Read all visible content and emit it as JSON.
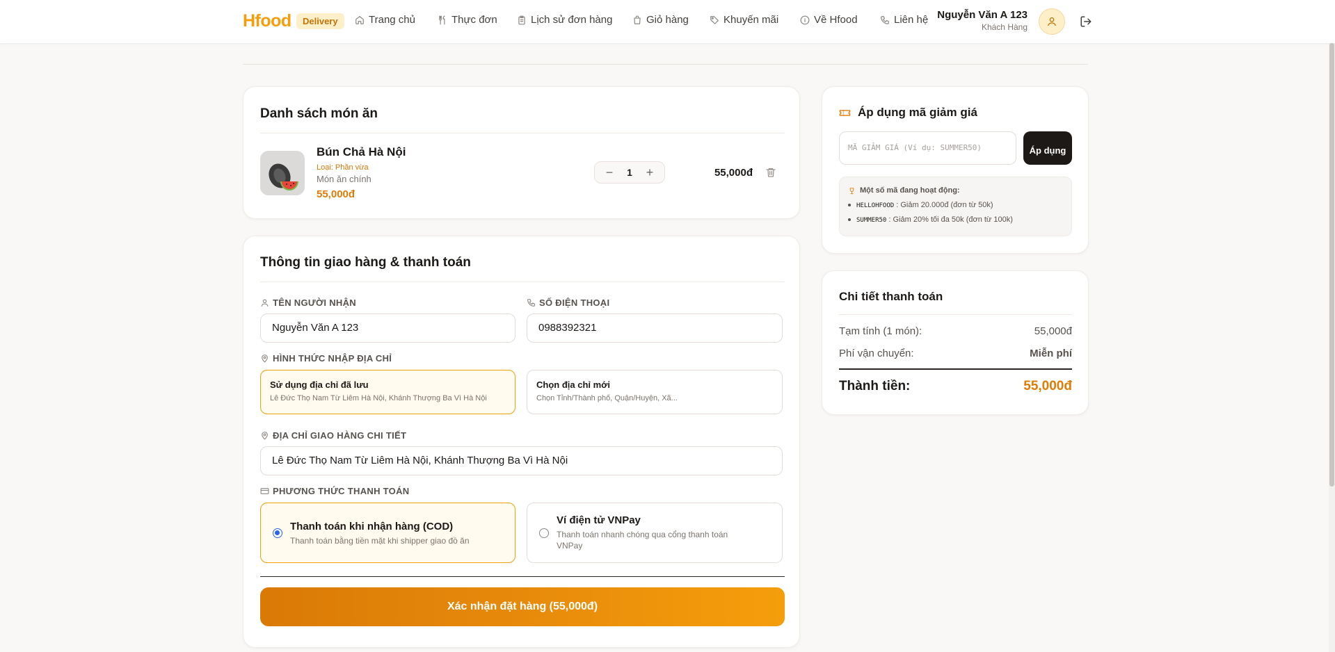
{
  "header": {
    "logo": "Hfood",
    "badge": "Delivery",
    "nav": [
      {
        "label": "Trang chủ",
        "icon": "home-icon"
      },
      {
        "label": "Thực đơn",
        "icon": "utensils-icon"
      },
      {
        "label": "Lịch sử đơn hàng",
        "icon": "clipboard-icon"
      },
      {
        "label": "Giỏ hàng",
        "icon": "shopping-bag-icon"
      },
      {
        "label": "Khuyến mãi",
        "icon": "tag-icon"
      },
      {
        "label": "Về Hfood",
        "icon": "info-icon"
      },
      {
        "label": "Liên hệ",
        "icon": "phone-icon"
      }
    ],
    "user_name": "Nguyễn Văn A 123",
    "user_role": "Khách Hàng"
  },
  "cart": {
    "title": "Danh sách món ăn",
    "items": [
      {
        "name": "Bún Chả Hà Nội",
        "type": "Loại: Phần vừa",
        "category": "Món ăn chính",
        "price": "55,000đ",
        "quantity": "1",
        "total": "55,000đ"
      }
    ]
  },
  "shipping": {
    "title": "Thông tin giao hàng & thanh toán",
    "receiver_label": "TÊN NGƯỜI NHẬN",
    "receiver_value": "Nguyễn Văn A 123",
    "phone_label": "SỐ ĐIỆN THOẠI",
    "phone_value": "0988392321",
    "address_mode_label": "HÌNH THỨC NHẬP ĐỊA CHỈ",
    "saved_title": "Sử dụng địa chỉ đã lưu",
    "saved_sub": "Lê Đức Thọ Nam Từ Liêm Hà Nội, Khánh Thượng Ba Vì Hà Nội",
    "new_title": "Chọn địa chỉ mới",
    "new_sub": "Chọn Tỉnh/Thành phố, Quận/Huyện, Xã...",
    "detail_label": "ĐỊA CHỈ GIAO HÀNG CHI TIẾT",
    "detail_value": "Lê Đức Thọ Nam Từ Liêm Hà Nội, Khánh Thượng Ba Vì Hà Nội",
    "payment_label": "PHƯƠNG THỨC THANH TOÁN",
    "cod_title": "Thanh toán khi nhận hàng (COD)",
    "cod_sub": "Thanh toán bằng tiền mặt khi shipper giao đồ ăn",
    "vnpay_title": "Ví điện tử VNPay",
    "vnpay_sub": "Thanh toán nhanh chóng qua cổng thanh toán VNPay",
    "confirm_label": "Xác nhận đặt hàng (55,000đ)"
  },
  "coupon": {
    "title": "Áp dụng mã giảm giá",
    "placeholder": "MÃ GIẢM GIÁ (Ví dụ: SUMMER50)",
    "apply_label": "Áp dụng",
    "promo_head": "Một số mã đang hoạt động:",
    "promos": [
      {
        "code": "HELLOHFOOD",
        "desc": ": Giảm 20.000đ (đơn từ 50k)"
      },
      {
        "code": "SUMMER50",
        "desc": ": Giảm 20% tối đa 50k (đơn từ 100k)"
      }
    ]
  },
  "summary": {
    "title": "Chi tiết thanh toán",
    "subtotal_label": "Tạm tính (1 món):",
    "subtotal_value": "55,000đ",
    "shipping_label": "Phí vận chuyển:",
    "shipping_value": "Miễn phí",
    "total_label": "Thành tiền:",
    "total_value": "55,000đ"
  },
  "colors": {
    "accent": "#f59e0b",
    "accent_dark": "#e07b06",
    "dark": "#1c1917",
    "radio": "#2563eb"
  }
}
